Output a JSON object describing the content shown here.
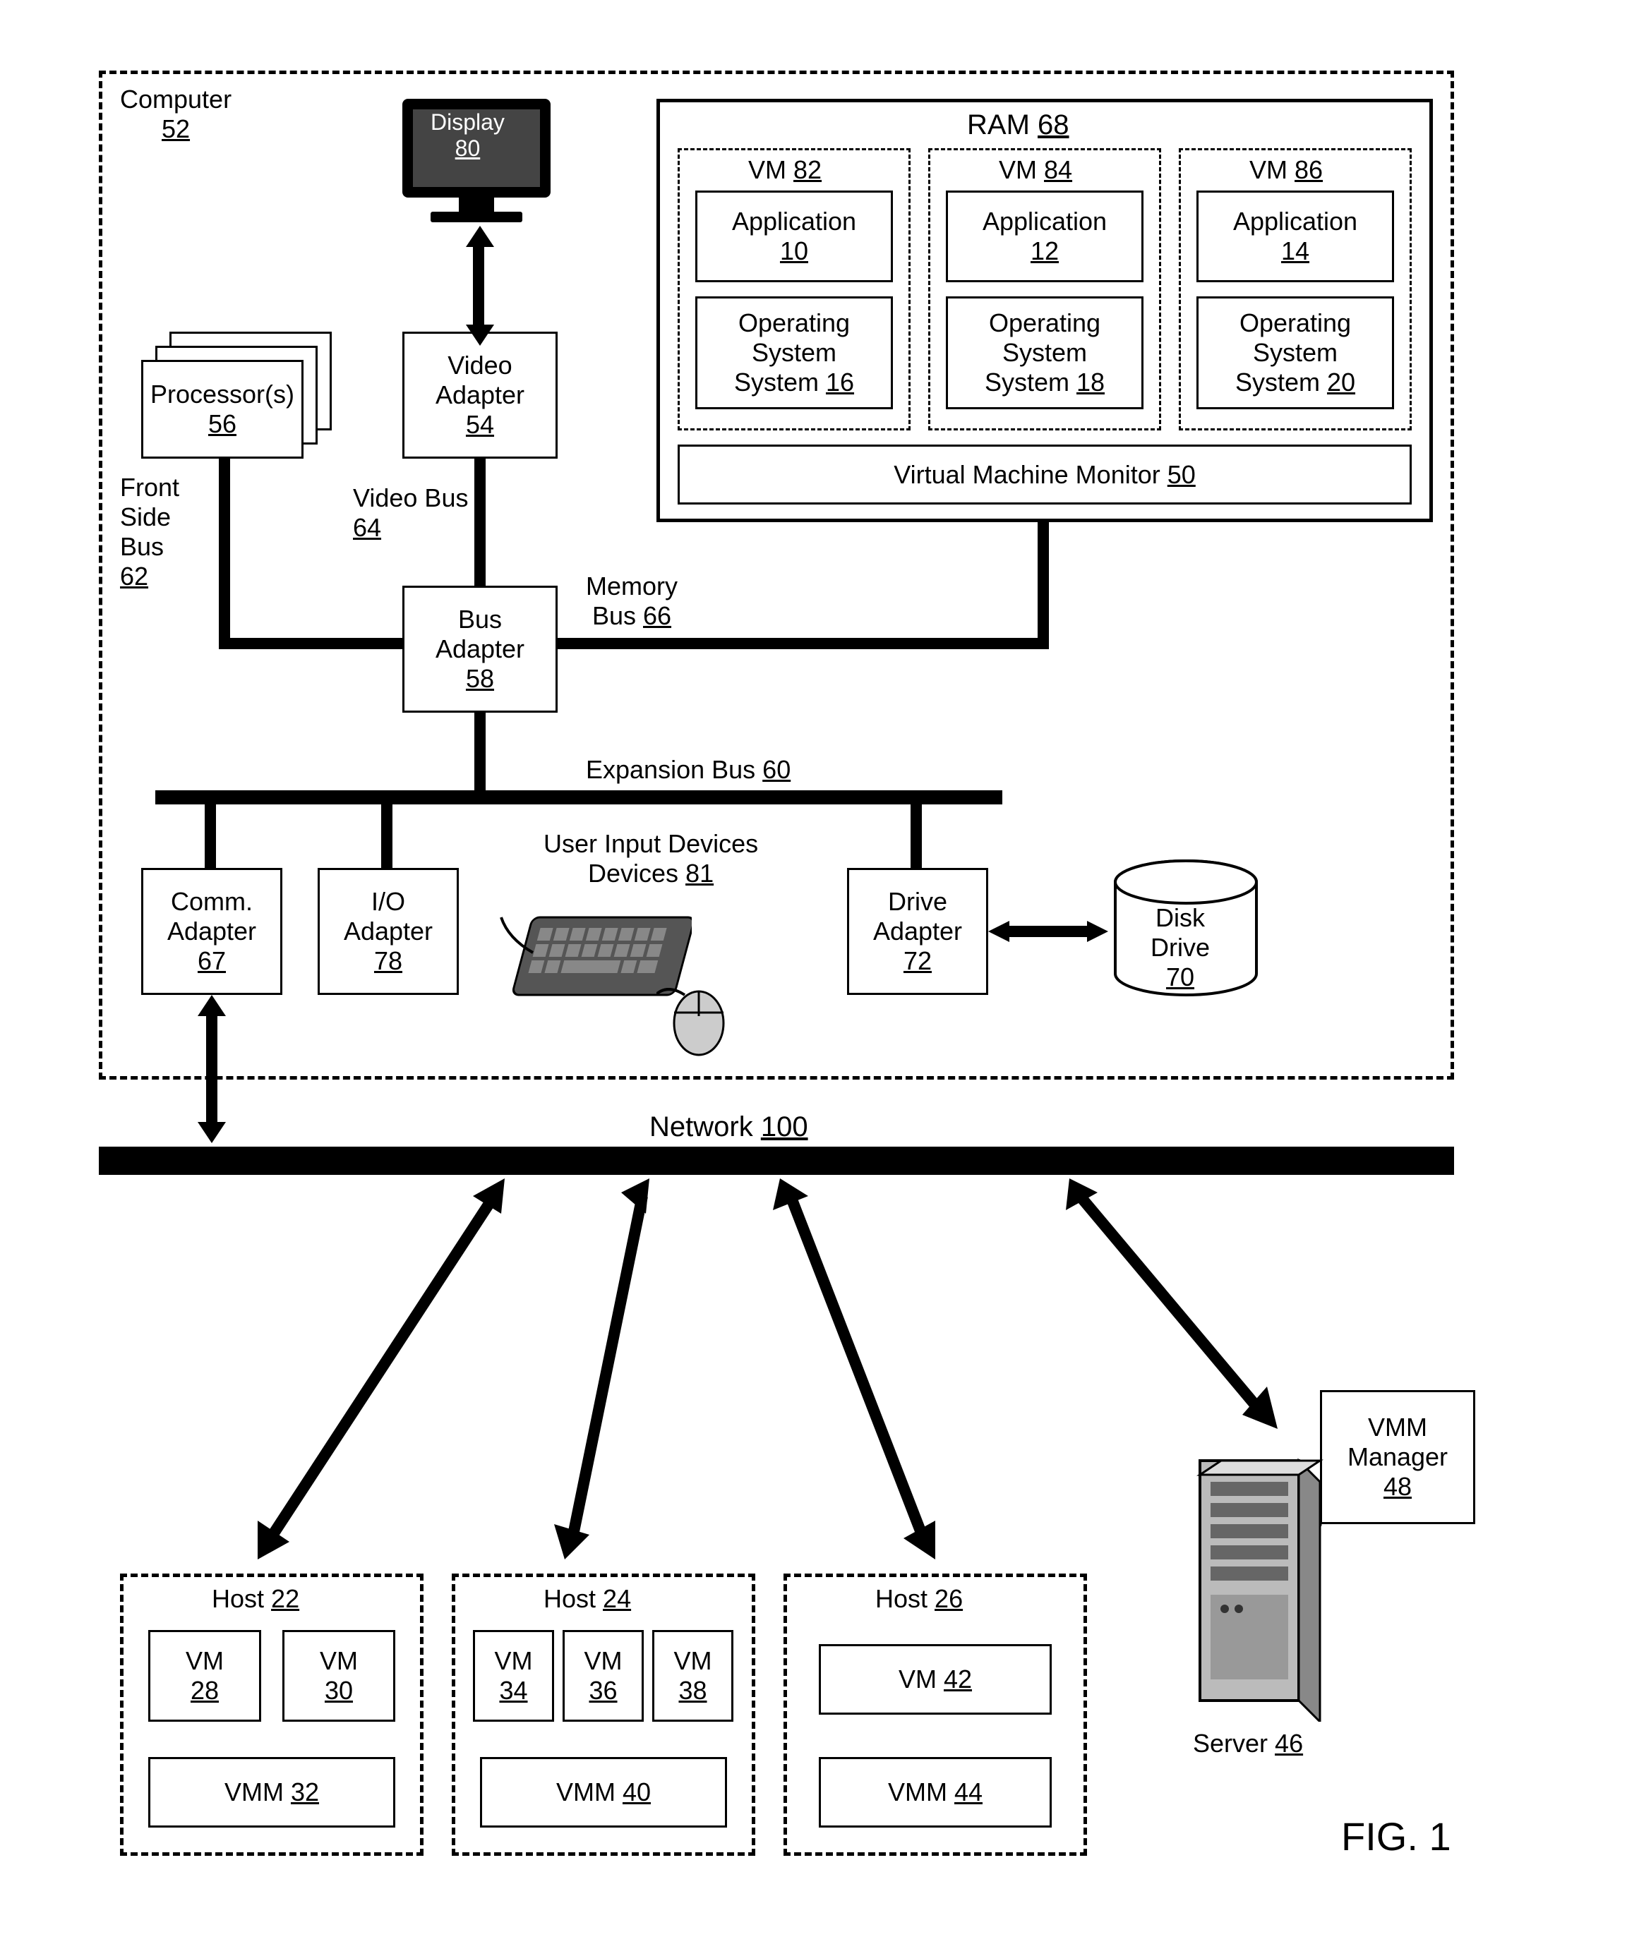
{
  "computer": {
    "label": "Computer",
    "num": "52"
  },
  "display": {
    "label": "Display",
    "num": "80"
  },
  "ram": {
    "label": "RAM",
    "num": "68"
  },
  "vm82": {
    "label": "VM",
    "num": "82"
  },
  "vm84": {
    "label": "VM",
    "num": "84"
  },
  "vm86": {
    "label": "VM",
    "num": "86"
  },
  "app10": {
    "label": "Application",
    "num": "10"
  },
  "app12": {
    "label": "Application",
    "num": "12"
  },
  "app14": {
    "label": "Application",
    "num": "14"
  },
  "os16": {
    "label": "Operating System",
    "num": "16"
  },
  "os18": {
    "label": "Operating System",
    "num": "18"
  },
  "os20": {
    "label": "Operating System",
    "num": "20"
  },
  "vmm50": {
    "label": "Virtual Machine Monitor",
    "num": "50"
  },
  "processors": {
    "label": "Processor(s)",
    "num": "56"
  },
  "video_adapter": {
    "label": "Video Adapter",
    "num": "54"
  },
  "fsb": {
    "l1": "Front",
    "l2": "Side",
    "l3": "Bus",
    "num": "62"
  },
  "video_bus": {
    "label": "Video Bus",
    "num": "64"
  },
  "bus_adapter": {
    "label": "Bus Adapter",
    "num": "58"
  },
  "memory_bus": {
    "label": "Memory Bus",
    "num": "66"
  },
  "expansion_bus": {
    "label": "Expansion Bus",
    "num": "60"
  },
  "comm_adapter": {
    "label": "Comm. Adapter",
    "num": "67"
  },
  "io_adapter": {
    "label": "I/O Adapter",
    "num": "78"
  },
  "user_input": {
    "label": "User Input Devices",
    "num": "81"
  },
  "drive_adapter": {
    "label": "Drive Adapter",
    "num": "72"
  },
  "disk_drive": {
    "label": "Disk Drive",
    "num": "70"
  },
  "network": {
    "label": "Network",
    "num": "100"
  },
  "host22": {
    "label": "Host",
    "num": "22"
  },
  "host24": {
    "label": "Host",
    "num": "24"
  },
  "host26": {
    "label": "Host",
    "num": "26"
  },
  "vm28": {
    "label": "VM",
    "num": "28"
  },
  "vm30": {
    "label": "VM",
    "num": "30"
  },
  "vm34": {
    "label": "VM",
    "num": "34"
  },
  "vm36": {
    "label": "VM",
    "num": "36"
  },
  "vm38": {
    "label": "VM",
    "num": "38"
  },
  "vm42": {
    "label": "VM",
    "num": "42"
  },
  "vmm32": {
    "label": "VMM",
    "num": "32"
  },
  "vmm40": {
    "label": "VMM",
    "num": "40"
  },
  "vmm44": {
    "label": "VMM",
    "num": "44"
  },
  "server": {
    "label": "Server",
    "num": "46"
  },
  "vmm_manager": {
    "label": "VMM Manager",
    "num": "48"
  },
  "fig": "FIG. 1"
}
